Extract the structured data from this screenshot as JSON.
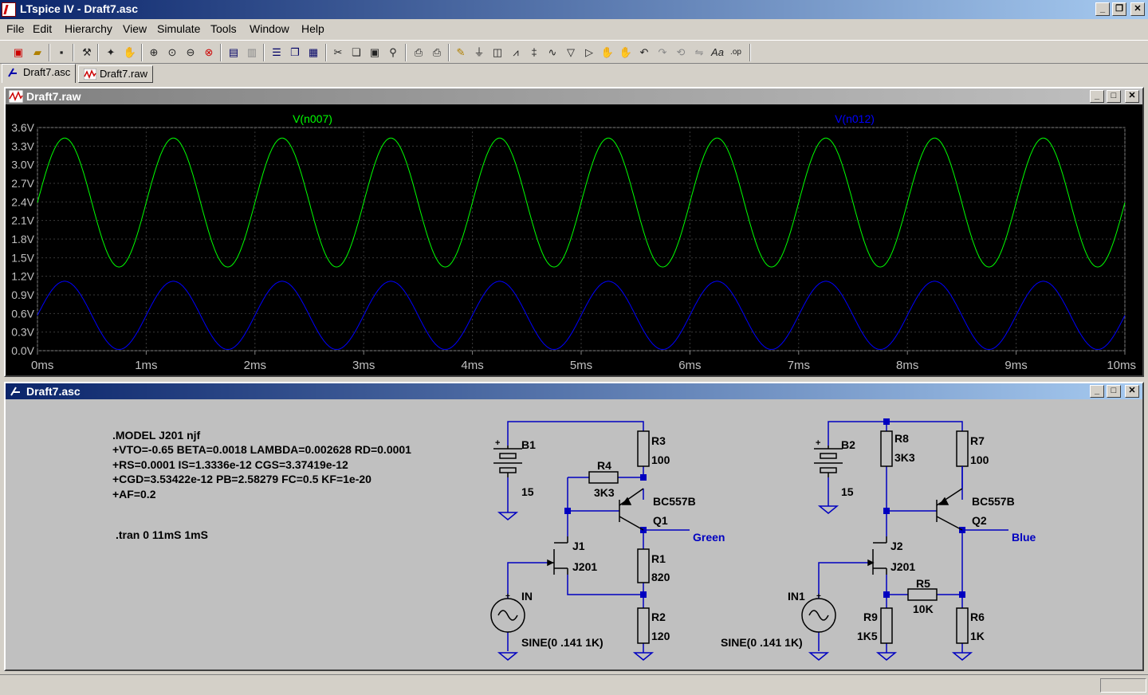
{
  "app": {
    "title": "LTspice IV - Draft7.asc",
    "window_buttons": [
      "_",
      "❐",
      "✕"
    ]
  },
  "menu": [
    "File",
    "Edit",
    "Hierarchy",
    "View",
    "Simulate",
    "Tools",
    "Window",
    "Help"
  ],
  "toolbar_icons": [
    "new-schematic-icon",
    "open-icon",
    "save-icon",
    "control-panel-icon",
    "run-icon",
    "halt-icon",
    "zoom-in-icon",
    "zoom-out-icon",
    "zoom-fit-icon",
    "zoom-cancel-icon",
    "autorange-icon",
    "fft-icon",
    "tile-horizontal-icon",
    "cascade-icon",
    "tile-vertical-icon",
    "cut-icon",
    "copy-icon",
    "paste-icon",
    "find-icon",
    "print-icon",
    "print-setup-icon",
    "wire-icon",
    "ground-icon",
    "label-net-icon",
    "resistor-icon",
    "capacitor-icon",
    "inductor-icon",
    "diode-icon",
    "component-icon",
    "move-icon",
    "drag-icon",
    "undo-icon",
    "redo-icon",
    "rotate-icon",
    "mirror-icon",
    "text-icon",
    "spice-directive-icon"
  ],
  "tabs": [
    "Draft7.asc",
    "Draft7.raw"
  ],
  "waveform_panel": {
    "title": "Draft7.raw",
    "traces": [
      {
        "name": "V(n007)",
        "color": "#00ff00"
      },
      {
        "name": "V(n012)",
        "color": "#0000ff"
      }
    ]
  },
  "chart_data": {
    "type": "line",
    "ylim": [
      0,
      3.6
    ],
    "xlim": [
      0,
      10
    ],
    "yticks": [
      "3.6V",
      "3.3V",
      "3.0V",
      "2.7V",
      "2.4V",
      "2.1V",
      "1.8V",
      "1.5V",
      "1.2V",
      "0.9V",
      "0.6V",
      "0.3V",
      "0.0V"
    ],
    "xticks": [
      "0ms",
      "1ms",
      "2ms",
      "3ms",
      "4ms",
      "5ms",
      "6ms",
      "7ms",
      "8ms",
      "9ms",
      "10ms"
    ],
    "grid": true,
    "series": [
      {
        "name": "V(n007)",
        "color": "#00ff00",
        "offset": 2.39,
        "amplitude": 1.04,
        "frequency_khz": 1,
        "phase_deg": 0
      },
      {
        "name": "V(n012)",
        "color": "#0000ff",
        "offset": 0.57,
        "amplitude": 0.55,
        "frequency_khz": 1,
        "phase_deg": 0
      }
    ]
  },
  "schematic_panel": {
    "title": "Draft7.asc",
    "directives": {
      "model": [
        ".MODEL J201 njf",
        "+VTO=-0.65 BETA=0.0018 LAMBDA=0.002628 RD=0.0001",
        "+RS=0.0001 IS=1.3336e-12 CGS=3.37419e-12",
        "+CGD=3.53422e-12 PB=2.58279 FC=0.5 KF=1e-20",
        "+AF=0.2"
      ],
      "tran": ".tran 0 11mS 1mS"
    },
    "left_circuit": {
      "b1": "B1",
      "b1_val": "15",
      "r3": "R3",
      "r3_val": "100",
      "r4": "R4",
      "r4_val": "3K3",
      "q1_model": "BC557B",
      "q1": "Q1",
      "j1": "J1",
      "j1_model": "J201",
      "r1": "R1",
      "r1_val": "820",
      "r2": "R2",
      "r2_val": "120",
      "in": "IN",
      "in_val": "SINE(0 .141 1K)",
      "out_label": "Green"
    },
    "right_circuit": {
      "b2": "B2",
      "b2_val": "15",
      "r8": "R8",
      "r8_val": "3K3",
      "r7": "R7",
      "r7_val": "100",
      "q2_model": "BC557B",
      "q2": "Q2",
      "j2": "J2",
      "j2_model": "J201",
      "r5": "R5",
      "r5_val": "10K",
      "r9": "R9",
      "r9_val": "1K5",
      "r6": "R6",
      "r6_val": "1K",
      "in1": "IN1",
      "in1_val": "SINE(0 .141 1K)",
      "out_label": "Blue"
    }
  }
}
